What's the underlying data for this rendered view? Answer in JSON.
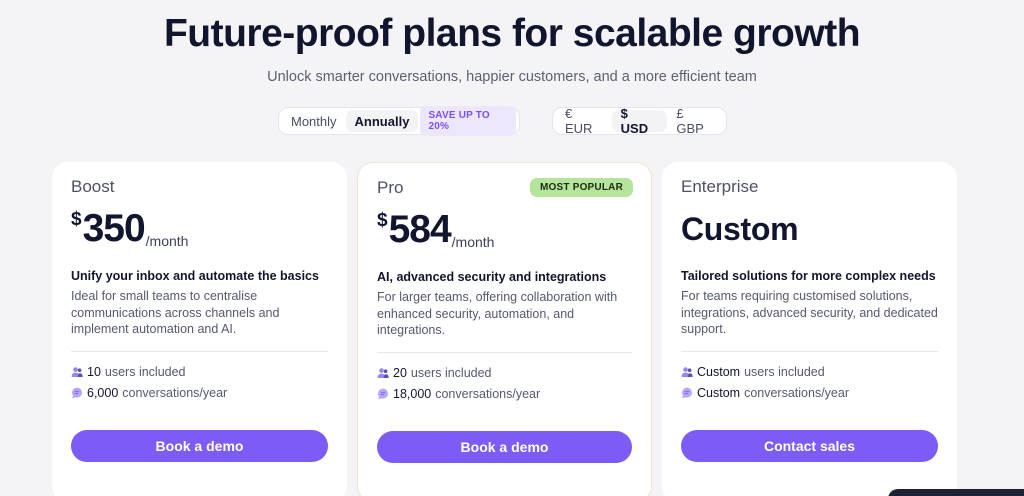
{
  "header": {
    "title": "Future-proof plans for scalable growth",
    "subtitle": "Unlock smarter conversations, happier customers, and a more efficient team"
  },
  "billing_toggle": {
    "options": [
      "Monthly",
      "Annually"
    ],
    "selected": "Annually",
    "save_badge": "SAVE UP TO 20%"
  },
  "currency_toggle": {
    "options": [
      "€ EUR",
      "$ USD",
      "£ GBP"
    ],
    "selected": "$ USD"
  },
  "plans": [
    {
      "name": "Boost",
      "currency_symbol": "$",
      "price": "350",
      "period": "/month",
      "tagline": "Unify your inbox and automate the basics",
      "description": "Ideal for small teams to centralise communications across channels and implement automation and AI.",
      "users_value": "10",
      "users_label": "users included",
      "conversations_value": "6,000",
      "conversations_label": "conversations/year",
      "cta": "Book a demo"
    },
    {
      "name": "Pro",
      "badge": "MOST POPULAR",
      "currency_symbol": "$",
      "price": "584",
      "period": "/month",
      "tagline": "AI, advanced security and integrations",
      "description": "For larger teams, offering collaboration with enhanced security, automation, and integrations.",
      "users_value": "20",
      "users_label": "users included",
      "conversations_value": "18,000",
      "conversations_label": "conversations/year",
      "cta": "Book a demo"
    },
    {
      "name": "Enterprise",
      "price_text": "Custom",
      "tagline": "Tailored solutions for more complex needs",
      "description": "For teams requiring customised solutions, integrations, advanced security, and dedicated support.",
      "users_value": "Custom",
      "users_label": "users included",
      "conversations_value": "Custom",
      "conversations_label": "conversations/year",
      "cta": "Contact sales"
    }
  ],
  "icons": {
    "users": "users-icon",
    "conversations": "chat-bubble-icon"
  },
  "colors": {
    "accent": "#7c5cf5",
    "badge_green": "#b5e59a",
    "save_badge_bg": "#ede7fd",
    "save_badge_text": "#7b4ff0",
    "heading": "#12152e"
  }
}
